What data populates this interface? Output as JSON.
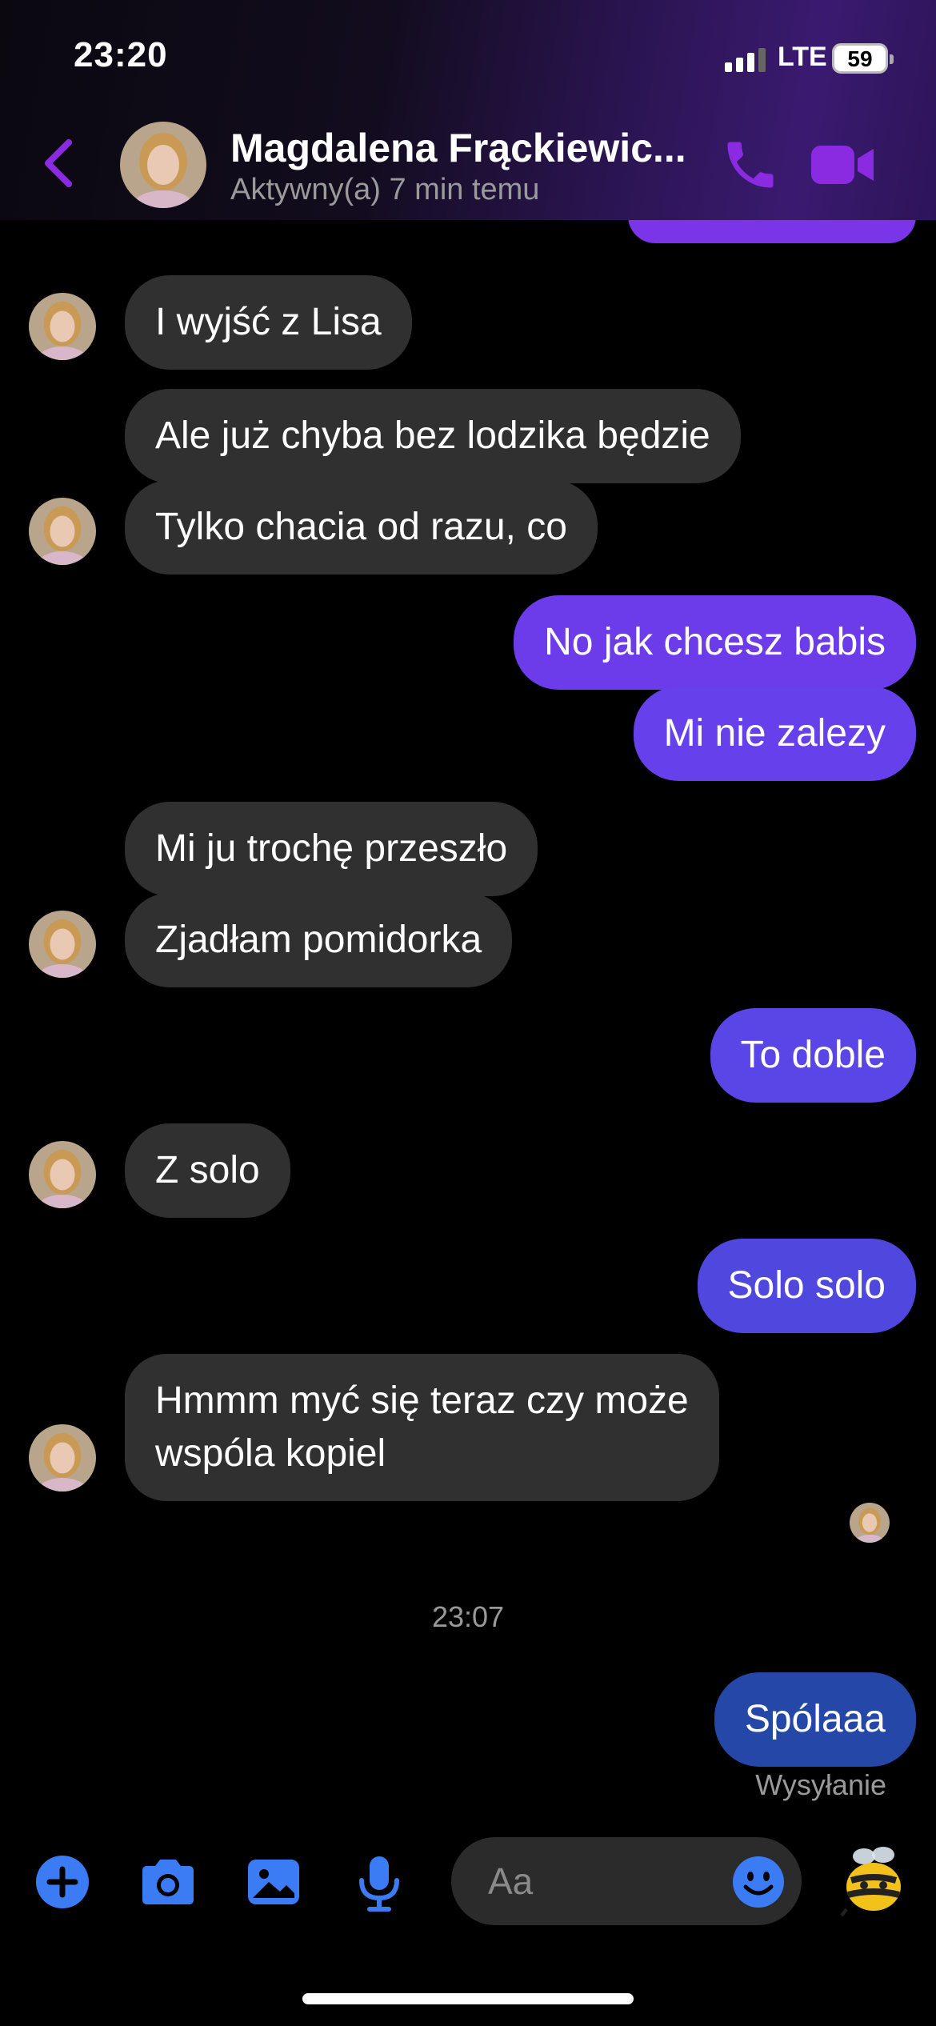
{
  "status_bar": {
    "time": "23:20",
    "network": "LTE",
    "battery": "59"
  },
  "header": {
    "contact_name": "Magdalena Frąckiewic...",
    "contact_status": "Aktywny(a) 7 min temu"
  },
  "colors": {
    "accent": "#7b2fe0",
    "incoming_bubble": "#303030",
    "outgoing_purple": "#6c3bea",
    "outgoing_blue": "#4f47de",
    "outgoing_sending": "#2447a8",
    "composer_blue": "#3b7cf5"
  },
  "messages": [
    {
      "text": "I wyjść z Lisa"
    },
    {
      "text": "Ale już chyba bez lodzika będzie"
    },
    {
      "text": "Tylko chacia od razu, co"
    },
    {
      "text": "No jak chcesz babis"
    },
    {
      "text": "Mi nie zalezy"
    },
    {
      "text": "Mi ju trochę przeszło"
    },
    {
      "text": "Zjadłam pomidorka"
    },
    {
      "text": "To doble"
    },
    {
      "text": "Z solo"
    },
    {
      "text": "Solo solo"
    },
    {
      "text_line1": "Hmmm myć się teraz czy może",
      "text_line2": "wspóla kopiel"
    },
    {
      "text": "Spólaaa"
    }
  ],
  "timestamp": "23:07",
  "sending_label": "Wysyłanie",
  "composer": {
    "placeholder": "Aa"
  },
  "icons": [
    "back-icon",
    "phone-icon",
    "video-icon",
    "plus-icon",
    "camera-icon",
    "image-icon",
    "microphone-icon",
    "emoji-icon",
    "bee-sticker-icon"
  ]
}
